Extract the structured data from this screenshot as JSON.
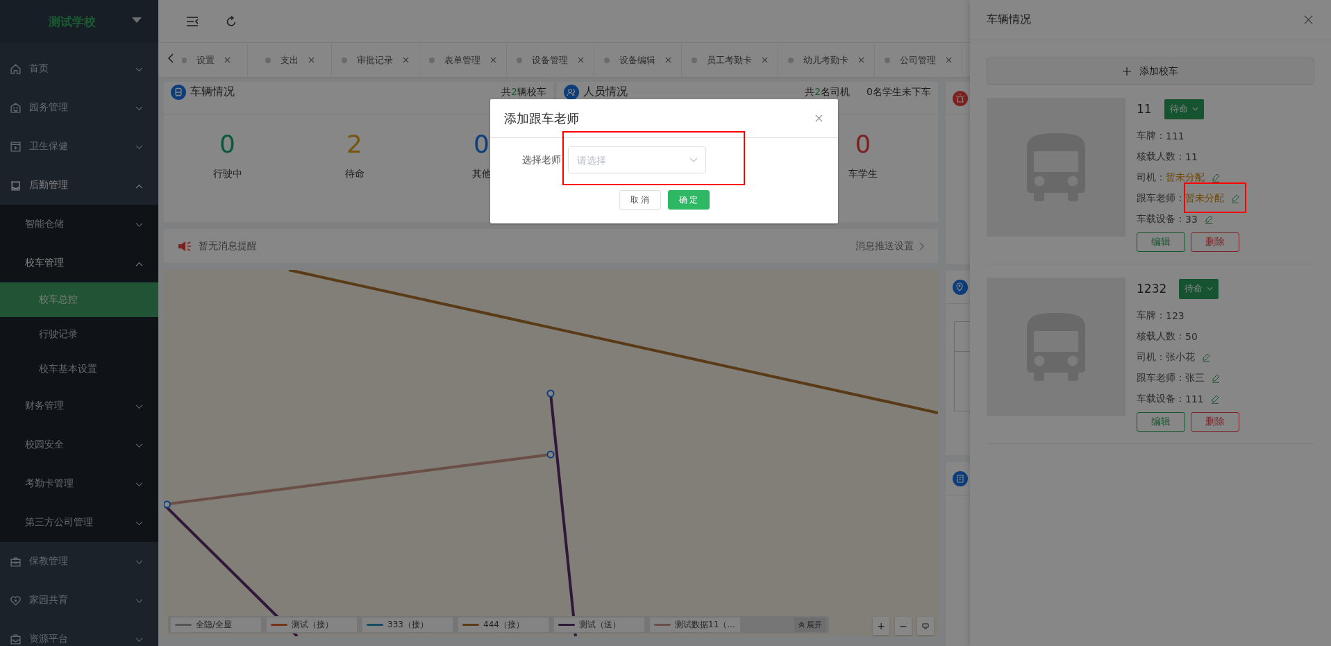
{
  "sidebar": {
    "title": "测试学校",
    "items": [
      {
        "label": "首页",
        "expanded": false,
        "selected": false
      },
      {
        "label": "园务管理",
        "expanded": false,
        "selected": false
      },
      {
        "label": "卫生保健",
        "expanded": false,
        "selected": false
      },
      {
        "label": "后勤管理",
        "expanded": true,
        "selected": false,
        "children": [
          {
            "label": "智能仓储",
            "expanded": false,
            "selected": false
          },
          {
            "label": "校车管理",
            "expanded": true,
            "selected": false,
            "children": [
              {
                "label": "校车总控",
                "selected": true
              },
              {
                "label": "行驶记录",
                "selected": false
              },
              {
                "label": "校车基本设置",
                "selected": false
              }
            ]
          },
          {
            "label": "财务管理",
            "expanded": false,
            "selected": false
          },
          {
            "label": "校园安全",
            "expanded": false,
            "selected": false
          },
          {
            "label": "考勤卡管理",
            "expanded": false,
            "selected": false
          },
          {
            "label": "第三方公司管理",
            "expanded": false,
            "selected": false
          }
        ]
      },
      {
        "label": "保教管理",
        "expanded": false,
        "selected": false
      },
      {
        "label": "家园共育",
        "expanded": false,
        "selected": false
      },
      {
        "label": "资源平台",
        "expanded": false,
        "selected": false
      }
    ]
  },
  "tabs": [
    {
      "label": "设置",
      "selected": false
    },
    {
      "label": "支出",
      "selected": false
    },
    {
      "label": "审批记录",
      "selected": false
    },
    {
      "label": "表单管理",
      "selected": false
    },
    {
      "label": "设备管理",
      "selected": false
    },
    {
      "label": "设备编辑",
      "selected": false
    },
    {
      "label": "员工考勤卡",
      "selected": false
    },
    {
      "label": "幼儿考勤卡",
      "selected": false
    },
    {
      "label": "公司管理",
      "selected": false
    }
  ],
  "vehicle_card": {
    "title": "车辆情况",
    "summary": {
      "prefix": "共",
      "count": "2",
      "suffix": "辆校车"
    },
    "stats": [
      {
        "value": "0",
        "label": "行驶中",
        "color": "#0b593d"
      },
      {
        "value": "2",
        "label": "待命",
        "color": "#775511"
      },
      {
        "value": "0",
        "label": "其他",
        "color": "#0e3d7b"
      }
    ]
  },
  "people_card": {
    "title": "人员情况",
    "summary": {
      "prefix": "共",
      "count": "2",
      "suffix": "名司机"
    },
    "note": "0名学生未下车",
    "stats": [
      {
        "value": "0",
        "label": "车学生",
        "color": "#7b2220"
      }
    ]
  },
  "notice": {
    "text": "暂无消息提醒",
    "link": "消息推送设置"
  },
  "map": {
    "legend": [
      {
        "label": "全隐/全显",
        "color": "#555555"
      },
      {
        "label": "测试（接）",
        "color": "#733417"
      },
      {
        "label": "333（接）",
        "color": "#164c63"
      },
      {
        "label": "444（接）",
        "color": "#593b18"
      },
      {
        "label": "测试（送）",
        "color": "#30183a"
      },
      {
        "label": "测试数据11（...",
        "color": "#694f46"
      }
    ],
    "expand": "展开",
    "zoom_in": "+",
    "zoom_out": "−"
  },
  "drawer": {
    "title": "车辆情况",
    "add_button": "添加校车",
    "vehicles": [
      {
        "name": "11",
        "status": "待命",
        "fields": [
          {
            "label": "车牌：",
            "value": "111",
            "assigned": true,
            "editable": false
          },
          {
            "label": "核载人数：",
            "value": "11",
            "assigned": true,
            "editable": false
          },
          {
            "label": "司机：",
            "value": "暂未分配",
            "assigned": false,
            "editable": true
          },
          {
            "label": "跟车老师：",
            "value": "暂未分配",
            "assigned": false,
            "editable": true
          },
          {
            "label": "车载设备：",
            "value": "33",
            "assigned": true,
            "editable": true
          }
        ],
        "edit": "编辑",
        "delete": "删除"
      },
      {
        "name": "1232",
        "status": "待命",
        "fields": [
          {
            "label": "车牌：",
            "value": "123",
            "assigned": true,
            "editable": false
          },
          {
            "label": "核载人数：",
            "value": "50",
            "assigned": true,
            "editable": false
          },
          {
            "label": "司机：",
            "value": "张小花",
            "assigned": true,
            "editable": true
          },
          {
            "label": "跟车老师：",
            "value": "张三",
            "assigned": true,
            "editable": true
          },
          {
            "label": "车载设备：",
            "value": "111",
            "assigned": true,
            "editable": true
          }
        ],
        "edit": "编辑",
        "delete": "删除"
      }
    ]
  },
  "dialog": {
    "title": "添加跟车老师",
    "field_label": "选择老师",
    "placeholder": "请选择",
    "cancel": "取 消",
    "ok": "确 定"
  }
}
